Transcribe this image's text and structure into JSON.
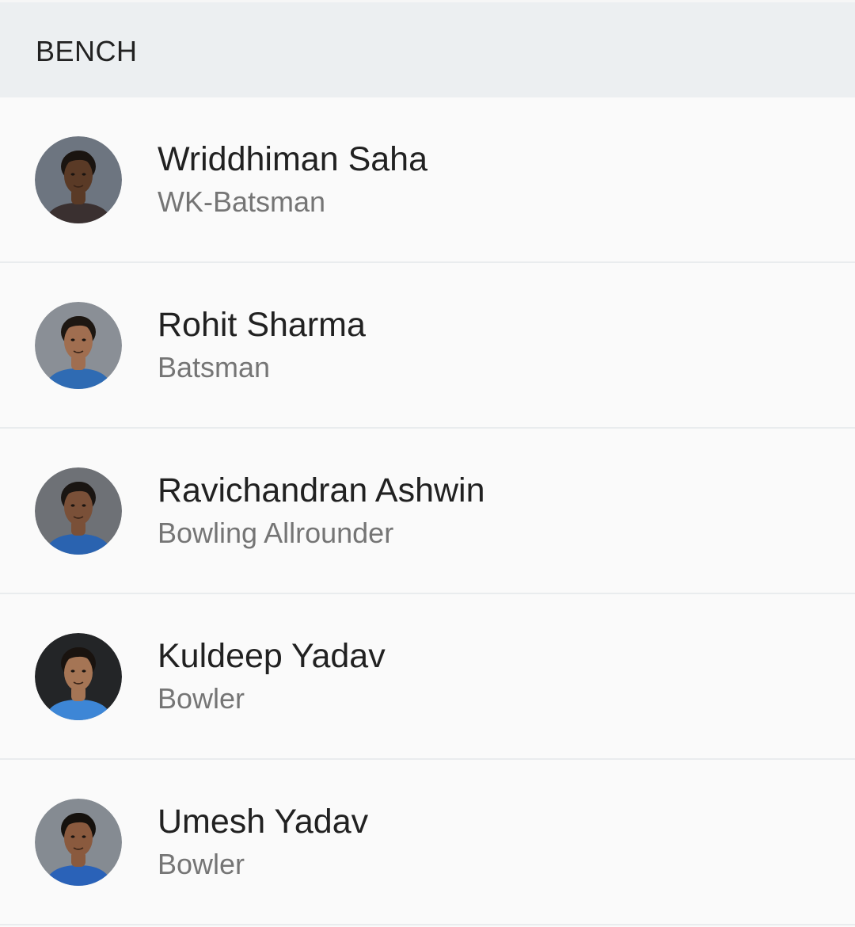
{
  "section": {
    "title": "BENCH"
  },
  "players": [
    {
      "name": "Wriddhiman Saha",
      "role": "WK-Batsman",
      "avatar_bg": "#6d7580",
      "skin": "#5a3a26",
      "hair": "#1a1410",
      "shirt": "#3a3030"
    },
    {
      "name": "Rohit Sharma",
      "role": "Batsman",
      "avatar_bg": "#8a8f96",
      "skin": "#a06e50",
      "hair": "#1d1712",
      "shirt": "#2f6bb3"
    },
    {
      "name": "Ravichandran Ashwin",
      "role": "Bowling Allrounder",
      "avatar_bg": "#6e7176",
      "skin": "#7a5038",
      "hair": "#1a1512",
      "shirt": "#2a63b0"
    },
    {
      "name": "Kuldeep Yadav",
      "role": "Bowler",
      "avatar_bg": "#232527",
      "skin": "#a57555",
      "hair": "#19130f",
      "shirt": "#3d86d6"
    },
    {
      "name": "Umesh Yadav",
      "role": "Bowler",
      "avatar_bg": "#858b92",
      "skin": "#8a5a3e",
      "hair": "#15110d",
      "shirt": "#2a62b8"
    }
  ]
}
